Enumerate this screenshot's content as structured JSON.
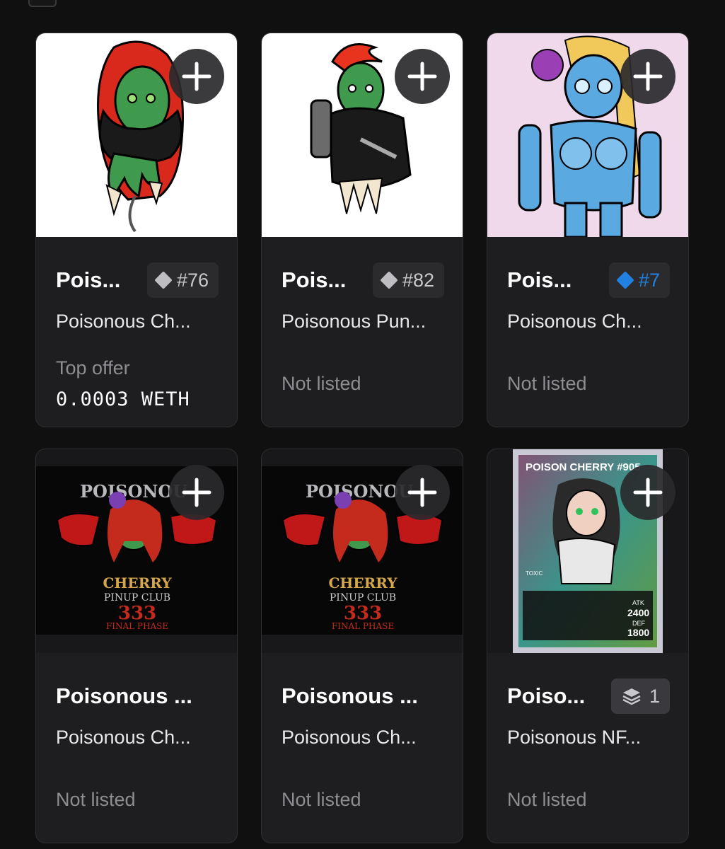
{
  "cards": [
    {
      "name": "Pois...",
      "badge": {
        "label": "#76",
        "icon": "diamond-icon",
        "color": "#bdbdc2"
      },
      "collection": "Poisonous Ch...",
      "offer_label": "Top offer",
      "offer_value": "0.0003 WETH"
    },
    {
      "name": "Pois...",
      "badge": {
        "label": "#82",
        "icon": "diamond-icon",
        "color": "#bdbdc2"
      },
      "collection": "Poisonous Pun...",
      "status": "Not listed"
    },
    {
      "name": "Pois...",
      "badge": {
        "label": "#7",
        "icon": "diamond-icon",
        "color": "#2081e2"
      },
      "collection": "Poisonous Ch...",
      "status": "Not listed"
    },
    {
      "name": "Poisonous ...",
      "collection": "Poisonous Ch...",
      "status": "Not listed",
      "artwork_text": {
        "line1": "POISONOU",
        "line2": "CHERRY",
        "line3": "PINUP CLUB",
        "line4": "333",
        "line5": "FINAL PHASE"
      }
    },
    {
      "name": "Poisonous ...",
      "collection": "Poisonous Ch...",
      "status": "Not listed",
      "artwork_text": {
        "line1": "POISONOU",
        "line2": "CHERRY",
        "line3": "PINUP CLUB",
        "line4": "333",
        "line5": "FINAL PHASE"
      }
    },
    {
      "name": "Poiso...",
      "badge": {
        "label": "1",
        "icon": "stack-icon"
      },
      "collection": "Poisonous NF...",
      "status": "Not listed",
      "artwork_text": {
        "title": "POISON CHERRY #905",
        "atk_label": "ATK",
        "atk": "2400",
        "def_label": "DEF",
        "def": "1800",
        "tag": "TOXIC"
      }
    }
  ],
  "colors": {
    "background": "#101011",
    "card": "#1e1e20",
    "accent_blue": "#2081e2"
  }
}
